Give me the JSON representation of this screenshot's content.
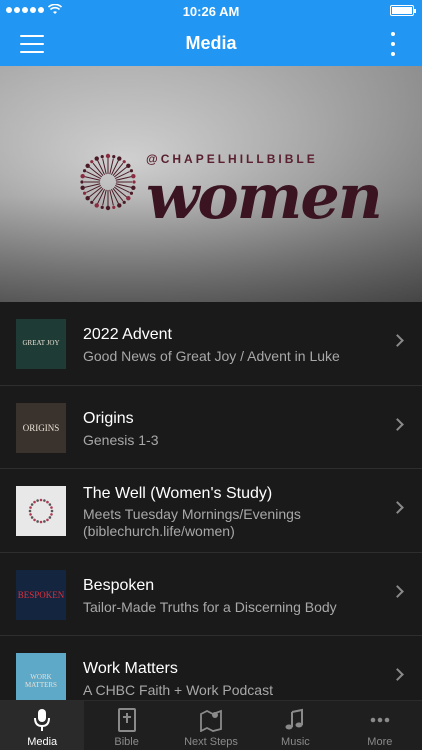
{
  "status_bar": {
    "time": "10:26 AM"
  },
  "nav": {
    "title": "Media"
  },
  "hero": {
    "handle": "@CHAPELHILLBIBLE",
    "word": "women",
    "slide_count": 4,
    "active_slide": 1
  },
  "media_list": [
    {
      "title": "2022 Advent",
      "subtitle": "Good News of Great Joy / Advent in Luke",
      "thumb_text": "GREAT JOY",
      "thumb_color": "#1f3b35"
    },
    {
      "title": "Origins",
      "subtitle": "Genesis 1-3",
      "thumb_text": "ORIGINS",
      "thumb_color": "#3a322d"
    },
    {
      "title": "The Well (Women's Study)",
      "subtitle": "Meets Tuesday Mornings/Evenings (biblechurch.life/women)",
      "thumb_text": "",
      "thumb_color": "#e8e8e8"
    },
    {
      "title": "Bespoken",
      "subtitle": "Tailor-Made Truths for a Discerning Body",
      "thumb_text": "BESPOKEN",
      "thumb_color": "#14253f"
    },
    {
      "title": "Work Matters",
      "subtitle": "A CHBC Faith + Work Podcast",
      "thumb_text": "WORK MATTERS",
      "thumb_color": "#5ea8c8"
    }
  ],
  "tabs": [
    {
      "label": "Media",
      "icon": "microphone-icon",
      "active": true
    },
    {
      "label": "Bible",
      "icon": "bible-icon",
      "active": false
    },
    {
      "label": "Next Steps",
      "icon": "map-pin-icon",
      "active": false
    },
    {
      "label": "Music",
      "icon": "music-note-icon",
      "active": false
    },
    {
      "label": "More",
      "icon": "more-horizontal-icon",
      "active": false
    }
  ],
  "colors": {
    "accent": "#2196f3",
    "list_bg": "#1a1a1a",
    "subtitle": "#a8a8a8"
  }
}
